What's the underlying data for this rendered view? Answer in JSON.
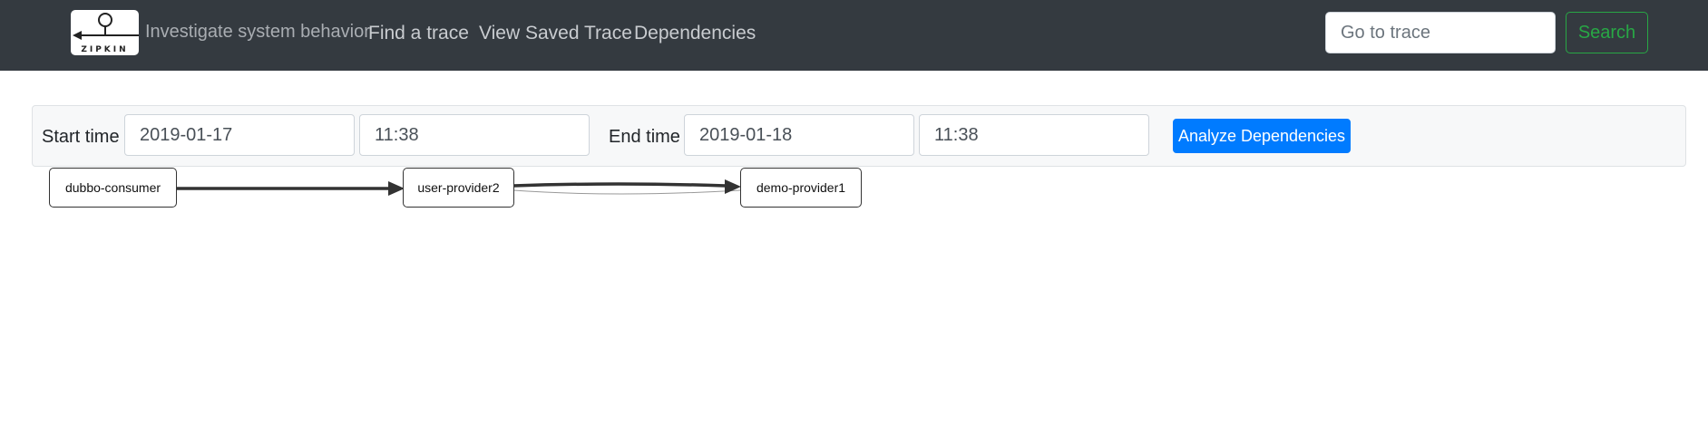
{
  "header": {
    "logo_text": "ZIPKIN",
    "tagline": "Investigate system behavior",
    "nav": [
      {
        "label": "Find a trace"
      },
      {
        "label": "View Saved Trace"
      },
      {
        "label": "Dependencies"
      }
    ],
    "trace_search": {
      "placeholder": "Go to trace",
      "value": ""
    },
    "search_label": "Search"
  },
  "filters": {
    "start_label": "Start time",
    "start_date": "2019-01-17",
    "start_time": "11:38",
    "end_label": "End time",
    "end_date": "2019-01-18",
    "end_time": "11:38",
    "analyze_label": "Analyze Dependencies"
  },
  "graph": {
    "nodes": [
      {
        "id": "dubbo-consumer",
        "label": "dubbo-consumer"
      },
      {
        "id": "user-provider2",
        "label": "user-provider2"
      },
      {
        "id": "demo-provider1",
        "label": "demo-provider1"
      }
    ],
    "edges": [
      {
        "from": "dubbo-consumer",
        "to": "user-provider2"
      },
      {
        "from": "user-provider2",
        "to": "demo-provider1"
      }
    ]
  },
  "colors": {
    "navbar": "#343a40",
    "primary": "#007bff",
    "success": "#28a745"
  }
}
